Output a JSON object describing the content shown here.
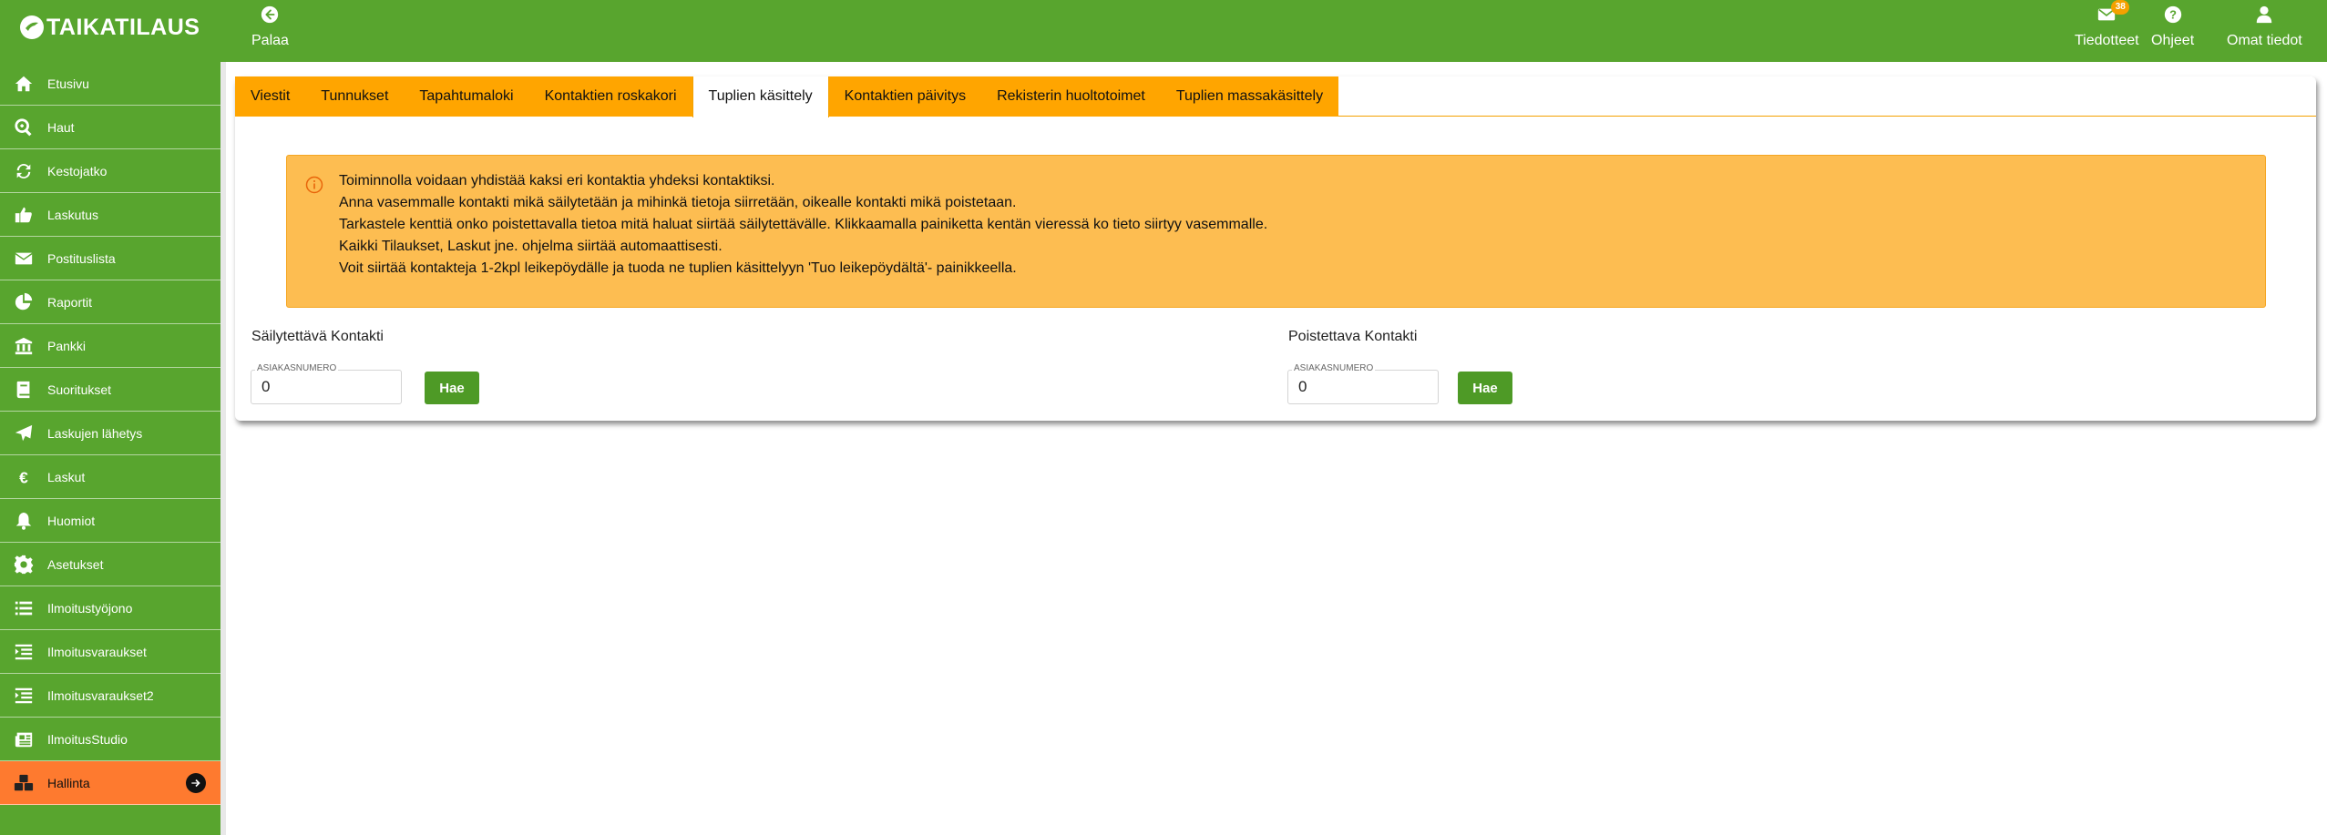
{
  "app": {
    "logo_text": "TAIKATILAUS",
    "back_label": "Palaa"
  },
  "header": {
    "items": [
      {
        "label": "Tiedotteet",
        "icon": "envelope-icon",
        "badge": "38"
      },
      {
        "label": "Ohjeet",
        "icon": "help-circle-icon"
      },
      {
        "label": "Omat tiedot",
        "icon": "user-icon"
      }
    ]
  },
  "sidebar": {
    "items": [
      {
        "label": "Etusivu",
        "icon": "home-icon"
      },
      {
        "label": "Haut",
        "icon": "search-icon"
      },
      {
        "label": "Kestojatko",
        "icon": "refresh-icon"
      },
      {
        "label": "Laskutus",
        "icon": "thumbs-up-icon"
      },
      {
        "label": "Postituslista",
        "icon": "envelope-icon"
      },
      {
        "label": "Raportit",
        "icon": "pie-chart-icon"
      },
      {
        "label": "Pankki",
        "icon": "bank-icon"
      },
      {
        "label": "Suoritukset",
        "icon": "book-icon"
      },
      {
        "label": "Laskujen lähetys",
        "icon": "paper-plane-icon"
      },
      {
        "label": "Laskut",
        "icon": "euro-icon"
      },
      {
        "label": "Huomiot",
        "icon": "bell-icon"
      },
      {
        "label": "Asetukset",
        "icon": "gear-icon"
      },
      {
        "label": "Ilmoitustyöjono",
        "icon": "list-icon"
      },
      {
        "label": "Ilmoitusvaraukset",
        "icon": "indent-list-icon"
      },
      {
        "label": "Ilmoitusvaraukset2",
        "icon": "indent-list-icon"
      },
      {
        "label": "IlmoitusStudio",
        "icon": "newspaper-icon"
      },
      {
        "label": "Hallinta",
        "icon": "cubes-icon",
        "active": true
      }
    ]
  },
  "tabs": [
    {
      "label": "Viestit"
    },
    {
      "label": "Tunnukset"
    },
    {
      "label": "Tapahtumaloki"
    },
    {
      "label": "Kontaktien roskakori"
    },
    {
      "label": "Tuplien käsittely",
      "active": true
    },
    {
      "label": "Kontaktien päivitys"
    },
    {
      "label": "Rekisterin huoltotoimet"
    },
    {
      "label": "Tuplien massakäsittely"
    }
  ],
  "info": {
    "lines": [
      "Toiminnolla voidaan yhdistää kaksi eri kontaktia yhdeksi kontaktiksi.",
      "Anna vasemmalle kontakti mikä säilytetään ja mihinkä tietoja siirretään, oikealle kontakti mikä poistetaan.",
      "Tarkastele kenttiä onko poistettavalla tietoa mitä haluat siirtää säilytettävälle. Klikkaamalla painiketta kentän vieressä ko tieto siirtyy vasemmalle.",
      "Kaikki Tilaukset, Laskut jne. ohjelma siirtää automaattisesti.",
      "Voit siirtää kontakteja 1-2kpl leikepöydälle ja tuoda ne tuplien käsittelyyn 'Tuo leikepöydältä'- painikkeella."
    ]
  },
  "keep": {
    "title": "Säilytettävä Kontakti",
    "field_label": "ASIAKASNUMERO",
    "value": "0",
    "button": "Hae"
  },
  "remove": {
    "title": "Poistettava Kontakti",
    "field_label": "ASIAKASNUMERO",
    "value": "0",
    "button": "Hae"
  },
  "colors": {
    "brand_green": "#58a52e",
    "tab_orange": "#ffa500",
    "active_orange": "#fe7a2f",
    "info_bg": "#fdbd51"
  }
}
